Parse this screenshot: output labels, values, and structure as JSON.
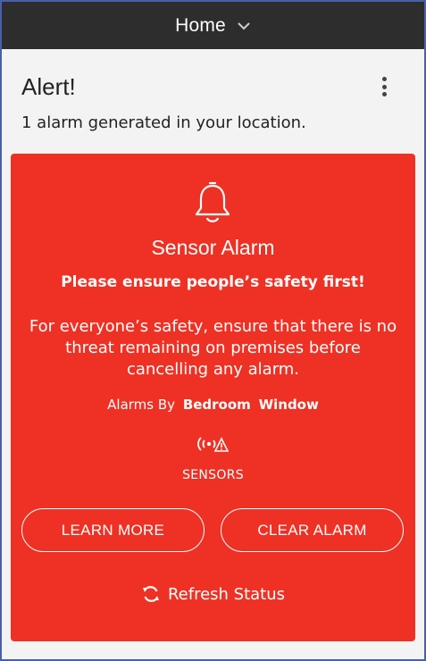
{
  "topbar": {
    "title": "Home",
    "dropdown_icon": "chevron-down-icon"
  },
  "header": {
    "title": "Alert!",
    "subtitle": "1 alarm generated in your location.",
    "menu_icon": "more-vertical-icon"
  },
  "alarm_card": {
    "icon": "bell-icon",
    "title": "Sensor Alarm",
    "warning": "Please ensure people’s safety first!",
    "body": "For everyone’s safety, ensure that there is no threat remaining on premises before cancelling any alarm.",
    "alarms_by_label": "Alarms By",
    "alarms_by_location": "Bedroom",
    "alarms_by_device": "Window",
    "sensor_icon": "sensor-alert-icon",
    "sensors_label": "SENSORS",
    "learn_more_label": "LEARN MORE",
    "clear_alarm_label": "CLEAR ALARM",
    "refresh_icon": "refresh-icon",
    "refresh_label": "Refresh Status",
    "background_color": "#ee3124"
  },
  "colors": {
    "topbar_bg": "#2d2d2d",
    "page_bg": "#f3f3f3",
    "alarm_red": "#ee3124"
  }
}
